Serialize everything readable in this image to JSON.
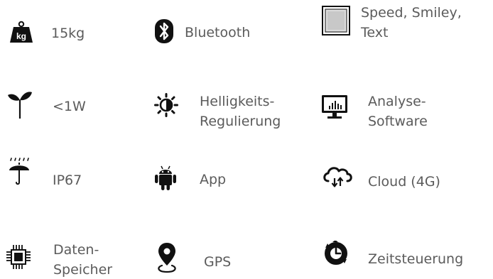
{
  "features": [
    {
      "id": "weight",
      "label": "15kg",
      "icon": "weight-kg-icon"
    },
    {
      "id": "bluetooth",
      "label": "Bluetooth",
      "icon": "bluetooth-icon"
    },
    {
      "id": "display",
      "label_lines": [
        "Speed, Smiley,",
        "Text"
      ],
      "icon": "display-panel-icon"
    },
    {
      "id": "power",
      "label": "<1W",
      "icon": "plant-sprout-icon"
    },
    {
      "id": "brightness",
      "label_lines": [
        "Helligkeits-",
        "Regulierung"
      ],
      "icon": "brightness-icon"
    },
    {
      "id": "analysis",
      "label_lines": [
        "Analyse-",
        "Software"
      ],
      "icon": "monitor-chart-icon"
    },
    {
      "id": "ip",
      "label": "IP67",
      "icon": "umbrella-rain-icon"
    },
    {
      "id": "app",
      "label": "App",
      "icon": "android-icon"
    },
    {
      "id": "cloud",
      "label": "Cloud (4G)",
      "icon": "cloud-sync-icon"
    },
    {
      "id": "storage",
      "label_lines": [
        "Daten-",
        "Speicher"
      ],
      "icon": "memory-chip-icon"
    },
    {
      "id": "gps",
      "label": "GPS",
      "icon": "map-pin-icon"
    },
    {
      "id": "timer",
      "label": "Zeitsteuerung",
      "icon": "clock-timer-icon"
    }
  ],
  "colors": {
    "icon": "#111111",
    "text": "#5b5b5b",
    "background": "#ffffff"
  }
}
